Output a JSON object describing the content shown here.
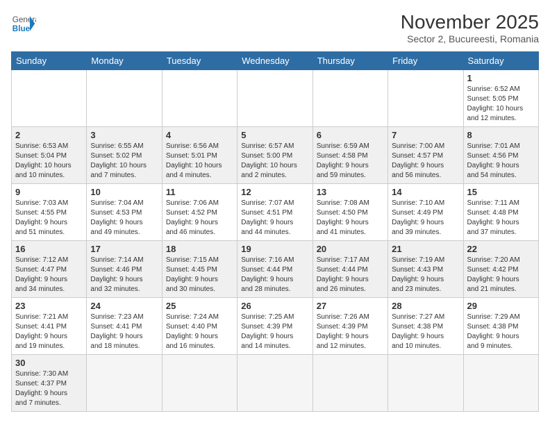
{
  "header": {
    "logo_general": "General",
    "logo_blue": "Blue",
    "month_title": "November 2025",
    "subtitle": "Sector 2, Bucureesti, Romania"
  },
  "weekdays": [
    "Sunday",
    "Monday",
    "Tuesday",
    "Wednesday",
    "Thursday",
    "Friday",
    "Saturday"
  ],
  "weeks": [
    [
      {
        "day": "",
        "info": ""
      },
      {
        "day": "",
        "info": ""
      },
      {
        "day": "",
        "info": ""
      },
      {
        "day": "",
        "info": ""
      },
      {
        "day": "",
        "info": ""
      },
      {
        "day": "",
        "info": ""
      },
      {
        "day": "1",
        "info": "Sunrise: 6:52 AM\nSunset: 5:05 PM\nDaylight: 10 hours\nand 12 minutes."
      }
    ],
    [
      {
        "day": "2",
        "info": "Sunrise: 6:53 AM\nSunset: 5:04 PM\nDaylight: 10 hours\nand 10 minutes."
      },
      {
        "day": "3",
        "info": "Sunrise: 6:55 AM\nSunset: 5:02 PM\nDaylight: 10 hours\nand 7 minutes."
      },
      {
        "day": "4",
        "info": "Sunrise: 6:56 AM\nSunset: 5:01 PM\nDaylight: 10 hours\nand 4 minutes."
      },
      {
        "day": "5",
        "info": "Sunrise: 6:57 AM\nSunset: 5:00 PM\nDaylight: 10 hours\nand 2 minutes."
      },
      {
        "day": "6",
        "info": "Sunrise: 6:59 AM\nSunset: 4:58 PM\nDaylight: 9 hours\nand 59 minutes."
      },
      {
        "day": "7",
        "info": "Sunrise: 7:00 AM\nSunset: 4:57 PM\nDaylight: 9 hours\nand 56 minutes."
      },
      {
        "day": "8",
        "info": "Sunrise: 7:01 AM\nSunset: 4:56 PM\nDaylight: 9 hours\nand 54 minutes."
      }
    ],
    [
      {
        "day": "9",
        "info": "Sunrise: 7:03 AM\nSunset: 4:55 PM\nDaylight: 9 hours\nand 51 minutes."
      },
      {
        "day": "10",
        "info": "Sunrise: 7:04 AM\nSunset: 4:53 PM\nDaylight: 9 hours\nand 49 minutes."
      },
      {
        "day": "11",
        "info": "Sunrise: 7:06 AM\nSunset: 4:52 PM\nDaylight: 9 hours\nand 46 minutes."
      },
      {
        "day": "12",
        "info": "Sunrise: 7:07 AM\nSunset: 4:51 PM\nDaylight: 9 hours\nand 44 minutes."
      },
      {
        "day": "13",
        "info": "Sunrise: 7:08 AM\nSunset: 4:50 PM\nDaylight: 9 hours\nand 41 minutes."
      },
      {
        "day": "14",
        "info": "Sunrise: 7:10 AM\nSunset: 4:49 PM\nDaylight: 9 hours\nand 39 minutes."
      },
      {
        "day": "15",
        "info": "Sunrise: 7:11 AM\nSunset: 4:48 PM\nDaylight: 9 hours\nand 37 minutes."
      }
    ],
    [
      {
        "day": "16",
        "info": "Sunrise: 7:12 AM\nSunset: 4:47 PM\nDaylight: 9 hours\nand 34 minutes."
      },
      {
        "day": "17",
        "info": "Sunrise: 7:14 AM\nSunset: 4:46 PM\nDaylight: 9 hours\nand 32 minutes."
      },
      {
        "day": "18",
        "info": "Sunrise: 7:15 AM\nSunset: 4:45 PM\nDaylight: 9 hours\nand 30 minutes."
      },
      {
        "day": "19",
        "info": "Sunrise: 7:16 AM\nSunset: 4:44 PM\nDaylight: 9 hours\nand 28 minutes."
      },
      {
        "day": "20",
        "info": "Sunrise: 7:17 AM\nSunset: 4:44 PM\nDaylight: 9 hours\nand 26 minutes."
      },
      {
        "day": "21",
        "info": "Sunrise: 7:19 AM\nSunset: 4:43 PM\nDaylight: 9 hours\nand 23 minutes."
      },
      {
        "day": "22",
        "info": "Sunrise: 7:20 AM\nSunset: 4:42 PM\nDaylight: 9 hours\nand 21 minutes."
      }
    ],
    [
      {
        "day": "23",
        "info": "Sunrise: 7:21 AM\nSunset: 4:41 PM\nDaylight: 9 hours\nand 19 minutes."
      },
      {
        "day": "24",
        "info": "Sunrise: 7:23 AM\nSunset: 4:41 PM\nDaylight: 9 hours\nand 18 minutes."
      },
      {
        "day": "25",
        "info": "Sunrise: 7:24 AM\nSunset: 4:40 PM\nDaylight: 9 hours\nand 16 minutes."
      },
      {
        "day": "26",
        "info": "Sunrise: 7:25 AM\nSunset: 4:39 PM\nDaylight: 9 hours\nand 14 minutes."
      },
      {
        "day": "27",
        "info": "Sunrise: 7:26 AM\nSunset: 4:39 PM\nDaylight: 9 hours\nand 12 minutes."
      },
      {
        "day": "28",
        "info": "Sunrise: 7:27 AM\nSunset: 4:38 PM\nDaylight: 9 hours\nand 10 minutes."
      },
      {
        "day": "29",
        "info": "Sunrise: 7:29 AM\nSunset: 4:38 PM\nDaylight: 9 hours\nand 9 minutes."
      }
    ],
    [
      {
        "day": "30",
        "info": "Sunrise: 7:30 AM\nSunset: 4:37 PM\nDaylight: 9 hours\nand 7 minutes."
      },
      {
        "day": "",
        "info": ""
      },
      {
        "day": "",
        "info": ""
      },
      {
        "day": "",
        "info": ""
      },
      {
        "day": "",
        "info": ""
      },
      {
        "day": "",
        "info": ""
      },
      {
        "day": "",
        "info": ""
      }
    ]
  ]
}
